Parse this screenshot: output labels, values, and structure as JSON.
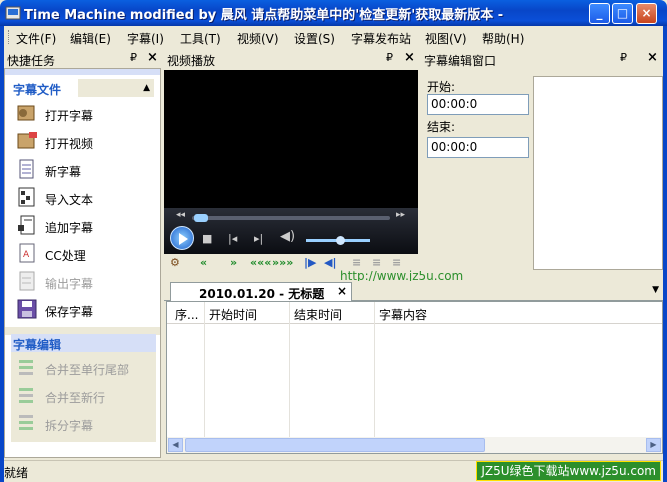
{
  "window": {
    "title": "Time Machine modified by 晨风 请点帮助菜单中的'检查更新'获取最新版本 -",
    "minimize": "_",
    "maximize": "□",
    "close": "×"
  },
  "menu": [
    "文件(F)",
    "编辑(E)",
    "字幕(I)",
    "工具(T)",
    "视频(V)",
    "设置(S)",
    "字幕发布站",
    "视图(V)",
    "帮助(H)"
  ],
  "panels": {
    "quick_tasks": {
      "title": "快捷任务",
      "pin": "₽",
      "close": "×"
    },
    "video": {
      "title": "视频播放",
      "pin": "₽",
      "close": "×"
    },
    "edit": {
      "title": "字幕编辑窗口",
      "pin": "₽",
      "close": "×"
    }
  },
  "quick_tasks": {
    "group1": {
      "title": "字幕文件",
      "items": [
        {
          "label": "打开字幕",
          "icon": "open-subtitle-icon",
          "enabled": true
        },
        {
          "label": "打开视频",
          "icon": "open-video-icon",
          "enabled": true
        },
        {
          "label": "新字幕",
          "icon": "new-subtitle-icon",
          "enabled": true
        },
        {
          "label": "导入文本",
          "icon": "import-text-icon",
          "enabled": true
        },
        {
          "label": "追加字幕",
          "icon": "append-subtitle-icon",
          "enabled": true
        },
        {
          "label": "CC处理",
          "icon": "cc-process-icon",
          "enabled": true
        },
        {
          "label": "输出字幕",
          "icon": "export-subtitle-icon",
          "enabled": false
        },
        {
          "label": "保存字幕",
          "icon": "save-icon",
          "enabled": true
        }
      ]
    },
    "group2": {
      "title": "字幕编辑",
      "items": [
        {
          "label": "合并至单行尾部",
          "icon": "merge-line-icon",
          "enabled": false
        },
        {
          "label": "合并至新行",
          "icon": "merge-newline-icon",
          "enabled": false
        },
        {
          "label": "拆分字幕",
          "icon": "split-icon",
          "enabled": false
        }
      ]
    }
  },
  "editor": {
    "start_label": "开始:",
    "start_value": "00:00:0",
    "end_label": "结束:",
    "end_value": "00:00:0"
  },
  "toolbar_url": "http://www.jz5u.com",
  "tab": {
    "label": "2010.01.20 - 无标题",
    "close": "×"
  },
  "table": {
    "columns": [
      "序...",
      "开始时间",
      "结束时间",
      "字幕内容"
    ]
  },
  "status": {
    "text": "就绪",
    "watermark": "JZ5U绿色下载站www.jz5u.com"
  },
  "colors": {
    "title_bar": "#0846c8",
    "group_title": "#215dc6",
    "watermark_bg": "#2c8f2c"
  }
}
